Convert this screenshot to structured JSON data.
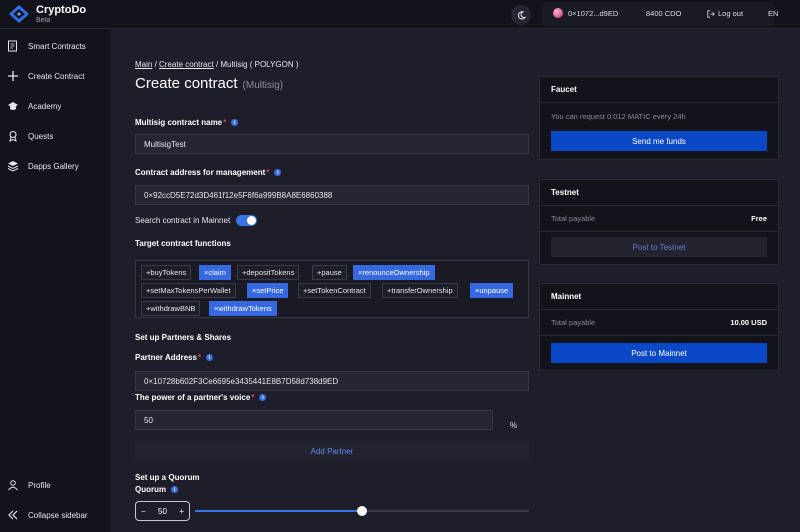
{
  "header": {
    "logo_name": "CryptoDo",
    "logo_badge": "Beta",
    "wallet_address": "0×1072...d9ED",
    "balance": "8400 CDO",
    "logout_label": "Log out",
    "language": "EN"
  },
  "sidebar": {
    "items": [
      {
        "label": "Smart Contracts",
        "icon": "contract-icon"
      },
      {
        "label": "Create Contract",
        "icon": "plus-icon"
      },
      {
        "label": "Academy",
        "icon": "academy-icon"
      },
      {
        "label": "Quests",
        "icon": "quests-icon"
      },
      {
        "label": "Dapps Gallery",
        "icon": "gallery-icon"
      }
    ],
    "profile_label": "Profile",
    "collapse_label": "Collapse sidebar"
  },
  "breadcrumb": {
    "main": "Main",
    "sep1": " / ",
    "create": "Create contract",
    "sep2": " / ",
    "current": "Multisig ( POLYGON )"
  },
  "page": {
    "title": "Create contract",
    "subtitle": "(Multisig)"
  },
  "form": {
    "name_label": "Multisig contract name",
    "name_value": "MultisigTest",
    "address_label": "Contract address for management",
    "address_value": "0×92ccD5E72d3D461f12e5F6f6a999B8A8E6860388",
    "search_mainnet_label": "Search contract in Mainnet",
    "search_mainnet_on": true,
    "functions_label": "Target contract functions",
    "functions": [
      {
        "label": "+buyTokens",
        "selected": false
      },
      {
        "label": "×claim",
        "selected": true
      },
      {
        "label": "+depositTokens",
        "selected": false
      },
      {
        "label": "+pause",
        "selected": false
      },
      {
        "label": "×renounceOwnership",
        "selected": true
      },
      {
        "label": "+setMaxTokensPerWallet",
        "selected": false
      },
      {
        "label": "×setPrice",
        "selected": true
      },
      {
        "label": "+setTokenContract",
        "selected": false
      },
      {
        "label": "+transferOwnership",
        "selected": false
      },
      {
        "label": "×unpause",
        "selected": true
      },
      {
        "label": "+withdrawBNB",
        "selected": false
      },
      {
        "label": "×withdrawTokens",
        "selected": true
      }
    ],
    "partners_section": "Set up Partners & Shares",
    "partner_address_label": "Partner Address",
    "partner_address_value": "0×10728b602F3Ce6695e3435441E8B7D58d738d9ED",
    "voice_label": "The power of a partner's voice",
    "voice_value": "50",
    "voice_unit": "%",
    "add_partner_label": "Add Partner",
    "quorum_section": "Set up a Quorum",
    "quorum_label": "Quorum",
    "quorum_value": "50",
    "quorum_level": 0.5,
    "stepper_minus": "−",
    "stepper_plus": "+"
  },
  "faucet": {
    "title": "Faucet",
    "text": "You can request 0.012 MATIC every 24h",
    "button": "Send me funds"
  },
  "testnet": {
    "title": "Testnet",
    "payable_label": "Total payable",
    "payable_value": "Free",
    "button": "Post to Testnet"
  },
  "mainnet": {
    "title": "Mainnet",
    "payable_label": "Total payable",
    "payable_value": "10.00 USD",
    "button": "Post to Mainnet"
  },
  "colors": {
    "accent": "#3668e0",
    "primary_button": "#0a48c8",
    "background": "#1e1e2a",
    "sidebar": "#13131b"
  }
}
